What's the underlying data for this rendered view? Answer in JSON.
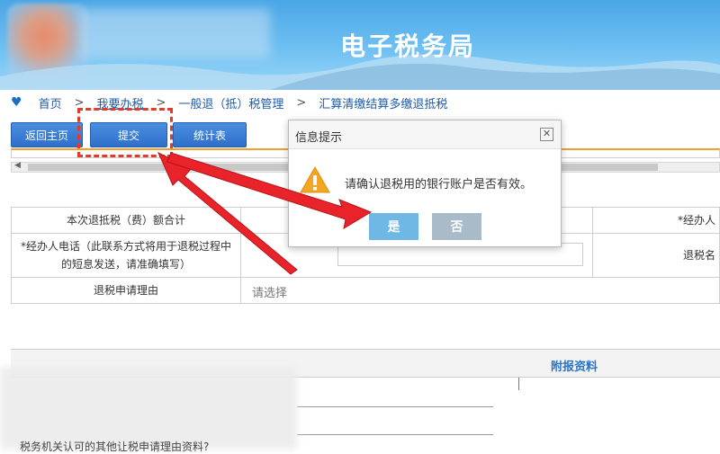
{
  "header": {
    "title": "电子税务局"
  },
  "breadcrumb": {
    "items": [
      "首页",
      "我要办税",
      "一般退（抵）税管理",
      "汇算清缴结算多缴退抵税"
    ],
    "separator": ">"
  },
  "toolbar": {
    "back_label": "返回主页",
    "submit_label": "提交",
    "stats_label": "统计表"
  },
  "form": {
    "total_label": "本次退抵税（费）额合计",
    "phone_label": "*经办人电话（此联系方式将用于退税过程中的短息发送，请准确填写）",
    "reason_label": "退税申请理由",
    "reason_placeholder": "请选择",
    "right_label_1": "*经办人",
    "right_label_2": "退税名"
  },
  "lower": {
    "section_title": "附报资料",
    "bottom_text": "税务机关认可的其他让税申请理由资料?"
  },
  "dialog": {
    "title": "信息提示",
    "close": "✕",
    "message": "请确认退税用的银行账户是否有效。",
    "yes": "是",
    "no": "否"
  },
  "colors": {
    "banner": "#4aa6e6",
    "button": "#2f6fca",
    "highlight": "#e53a2a",
    "arrow": "#e8232a",
    "accent_line": "#f0a030"
  }
}
